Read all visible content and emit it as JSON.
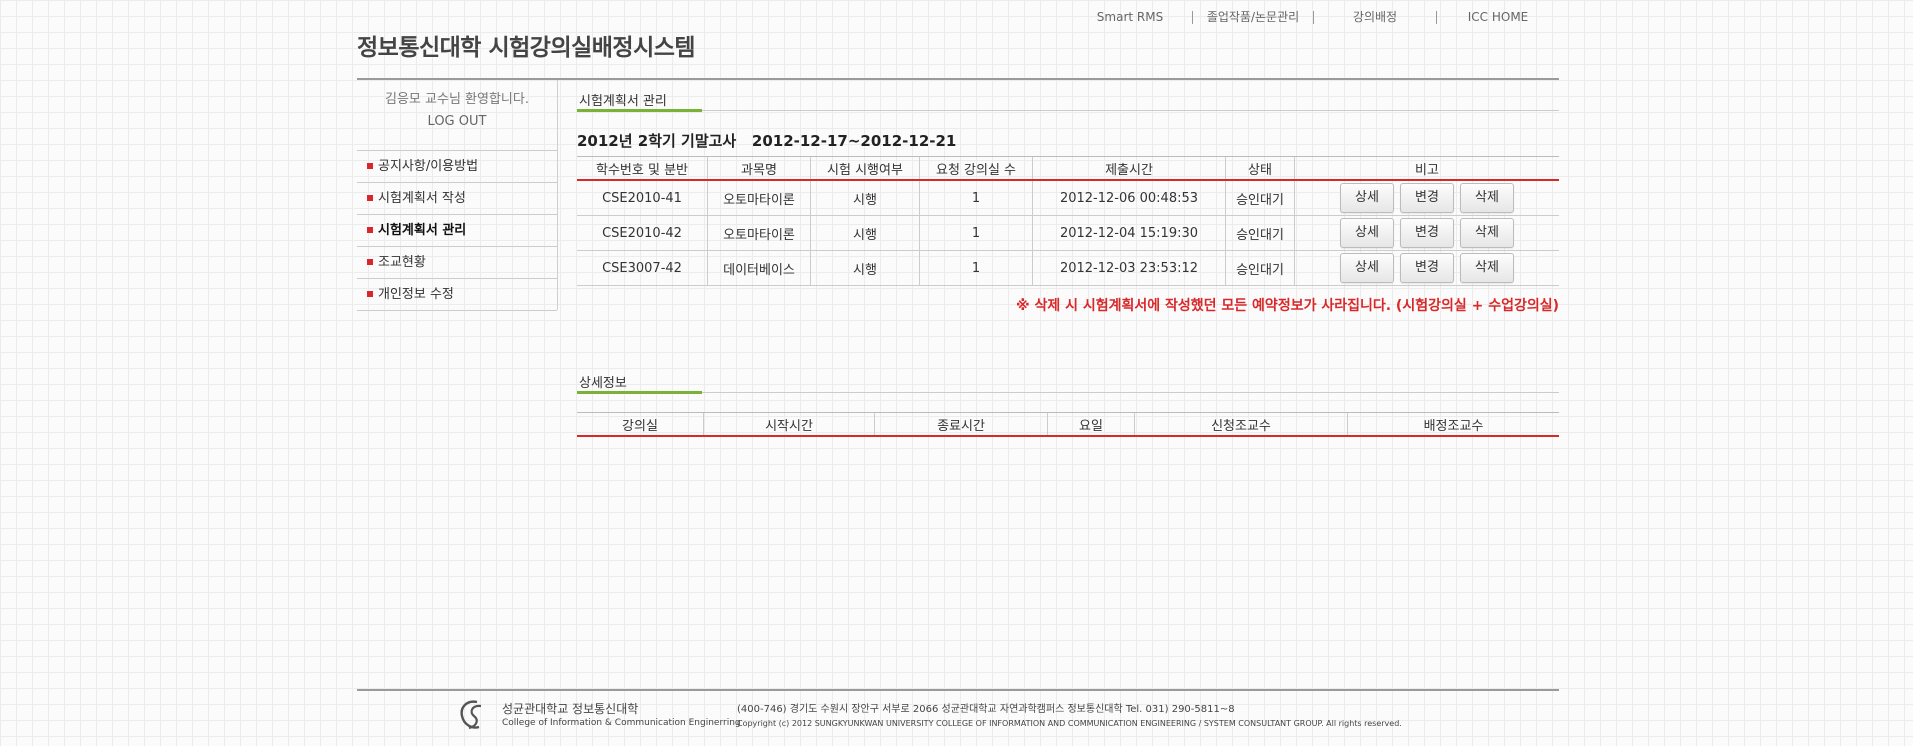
{
  "top_nav": [
    "Smart RMS",
    "졸업작품/논문관리",
    "강의배정",
    "ICC HOME"
  ],
  "site_title": "정보통신대학 시험강의실배정시스템",
  "sidebar": {
    "welcome": "김응모 교수님 환영합니다.",
    "logout": "LOG OUT",
    "menu": [
      "공지사항/이용방법",
      "시험계획서 작성",
      "시험계획서 관리",
      "조교현황",
      "개인정보 수정"
    ],
    "active_index": 2
  },
  "section1_title": "시험계획서 관리",
  "exam_heading": "2012년 2학기 기말고사   2012-12-17~2012-12-21",
  "plan_table": {
    "headers": [
      "학수번호 및 분반",
      "과목명",
      "시험 시행여부",
      "요청 강의실 수",
      "제출시간",
      "상태",
      "비고"
    ],
    "rows": [
      {
        "code": "CSE2010-41",
        "subject": "오토마타이론",
        "exam": "시행",
        "rooms": "1",
        "submitted": "2012-12-06 00:48:53",
        "status": "승인대기"
      },
      {
        "code": "CSE2010-42",
        "subject": "오토마타이론",
        "exam": "시행",
        "rooms": "1",
        "submitted": "2012-12-04 15:19:30",
        "status": "승인대기"
      },
      {
        "code": "CSE3007-42",
        "subject": "데이터베이스",
        "exam": "시행",
        "rooms": "1",
        "submitted": "2012-12-03 23:53:12",
        "status": "승인대기"
      }
    ],
    "buttons": {
      "detail": "상세",
      "edit": "변경",
      "delete": "삭제"
    }
  },
  "warning": "※ 삭제 시 시험계획서에 작성했던 모든 예약정보가 사라집니다. (시험강의실 + 수업강의실)",
  "section2_title": "상세정보",
  "detail_table": {
    "headers": [
      "강의실",
      "시작시간",
      "종료시간",
      "요일",
      "신청조교수",
      "배정조교수"
    ]
  },
  "footer": {
    "logo_kr": "성균관대학교 정보통신대학",
    "logo_en": "College of Information & Communication Enginerring",
    "address": "(400-746) 경기도 수원시 장안구 서부로 2066 성균관대학교 자연과학캠퍼스 정보통신대학 Tel. 031) 290-5811~8",
    "copyright": "Copyright (c) 2012 SUNGKYUNKWAN UNIVERSITY COLLEGE OF INFORMATION AND COMMUNICATION ENGINEERING / SYSTEM CONSULTANT GROUP. All rights reserved."
  },
  "colors": {
    "accent_red": "#d9282a",
    "accent_green": "#7ab235"
  }
}
